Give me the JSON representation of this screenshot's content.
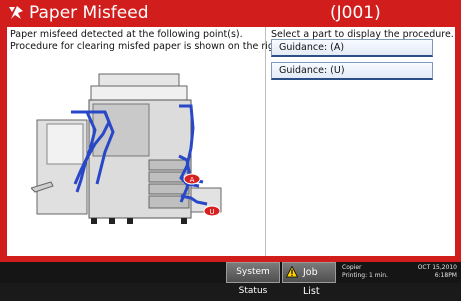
{
  "header": {
    "icon": "paper-misfeed-icon",
    "title": "Paper Misfeed",
    "code": "(J001)"
  },
  "left": {
    "line1": "Paper misfeed detected at the following point(s).",
    "line2": "Procedure for clearing misfed paper is shown on the right.",
    "markers": [
      "A",
      "U"
    ]
  },
  "right": {
    "instruction": "Select a part to display the procedure.",
    "guidance": [
      "Guidance: (A)",
      "Guidance: (U)"
    ]
  },
  "status": {
    "system_status": "System Status",
    "job_list": "Job List",
    "mode": "Copier",
    "printing": "Printing: 1 min.",
    "date": "OCT  15,2010",
    "time": "6:18PM"
  },
  "colors": {
    "frame": "#d21d1d",
    "marker": "#d92020",
    "path": "#2848c8"
  }
}
